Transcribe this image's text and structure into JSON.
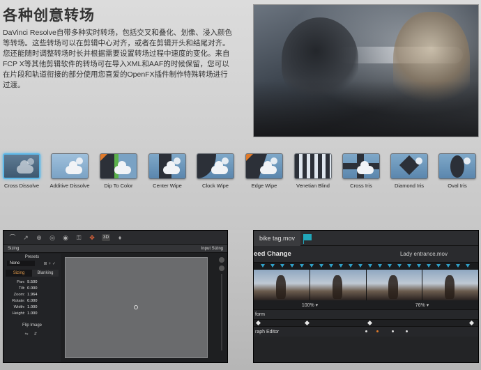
{
  "title": "各种创意转场",
  "intro_text": "DaVinci Resolve自带多种实时转场，包括交叉和叠化、划像、浸入颜色等转场。这些转场可以在剪辑中心对齐，或者在剪辑开头和结尾对齐。您还能随时调整转场时长并根据需要设置转场过程中速度的变化。来自FCP X等其他剪辑软件的转场可在导入XML和AAF的时候保留，您可以在片段和轨道衔接的部分使用您喜爱的OpenFX插件制作特殊转场进行过渡。",
  "transitions": [
    {
      "label": "Cross Dissolve",
      "selected": true
    },
    {
      "label": "Additive Dissolve"
    },
    {
      "label": "Dip To Color"
    },
    {
      "label": "Center Wipe"
    },
    {
      "label": "Clock Wipe"
    },
    {
      "label": "Edge Wipe"
    },
    {
      "label": "Venetian Blind"
    },
    {
      "label": "Cross Iris"
    },
    {
      "label": "Diamond Iris"
    },
    {
      "label": "Oval Iris"
    }
  ],
  "sizing_panel": {
    "header_left": "Sizing",
    "header_right": "Input Sizing",
    "presets_label": "Presets",
    "preset_value": "None",
    "tab_sizing": "Sizing",
    "tab_blanking": "Blanking",
    "params": [
      {
        "label": "Pan:",
        "value": "9.500"
      },
      {
        "label": "Tilt:",
        "value": "0.000"
      },
      {
        "label": "Zoom:",
        "value": "1.964"
      },
      {
        "label": "Rotate:",
        "value": "0.000"
      },
      {
        "label": "Width:",
        "value": "1.000"
      },
      {
        "label": "Height:",
        "value": "1.000"
      }
    ],
    "flip_label": "Flip Image",
    "toolbar_badge": "3D"
  },
  "timeline_panel": {
    "tab_label": "bike tag.mov",
    "speed_label": "eed Change",
    "clip_name": "Lady entrance.mov",
    "pct_left": "100%  ▾",
    "pct_right": "76%  ▾",
    "transform_label": "form",
    "graph_label": "raph Editor"
  }
}
